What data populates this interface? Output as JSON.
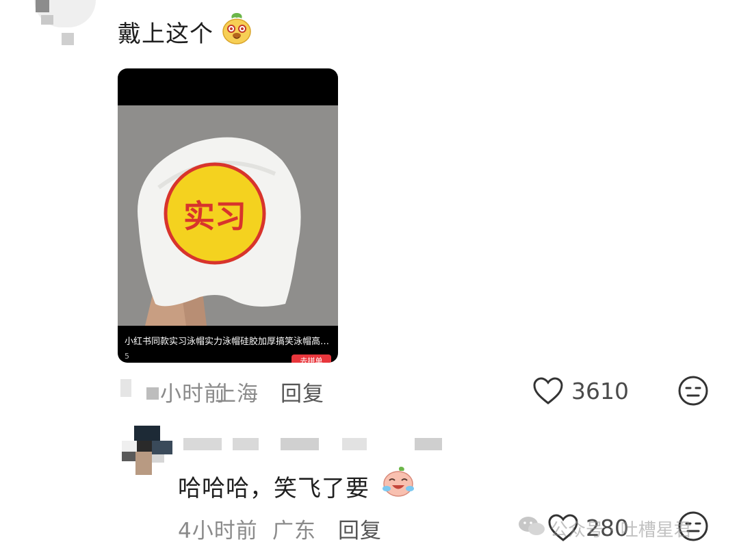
{
  "comment": {
    "text": "戴上这个",
    "emoji": "mango-face-emoji",
    "time": "小时前",
    "location": "上海",
    "reply_label": "回复",
    "like_count": "3610"
  },
  "product_card": {
    "badge_text": "实习",
    "caption": "小红书同款实习泳帽实力泳帽硅胶加厚搞笑泳帽高弹力...",
    "sub_text": "5",
    "tag_label": "去拼单"
  },
  "reply": {
    "text": "哈哈哈，笑飞了要",
    "emoji": "laughing-crying-emoji",
    "time": "4小时前",
    "location": "广东",
    "reply_label": "回复",
    "like_count": "280"
  },
  "watermark": {
    "text": "公众号 · 吐槽星君"
  },
  "colors": {
    "badge_yellow": "#f4d21f",
    "badge_red": "#d8342c",
    "meta_gray": "#8a8a8a"
  }
}
